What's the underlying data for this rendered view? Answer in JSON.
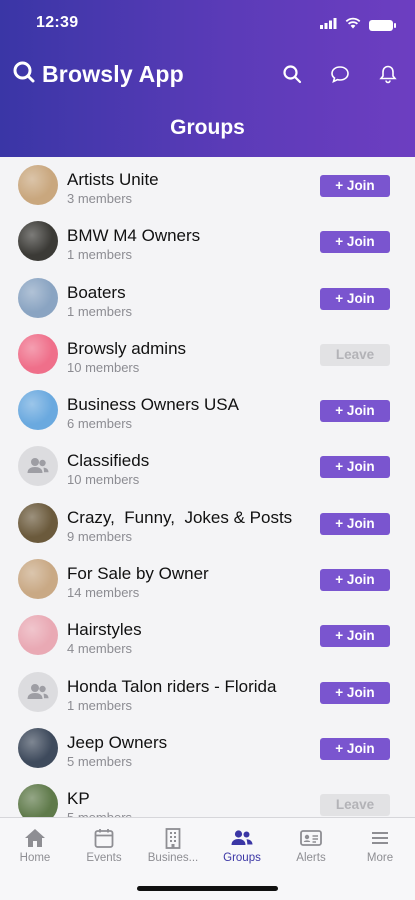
{
  "status": {
    "time": "12:39"
  },
  "app": {
    "title": "Browsly App",
    "page_title": "Groups"
  },
  "groups": [
    {
      "name": "Artists Unite",
      "members": "3 members",
      "action": "+ Join",
      "avatar_color": "#c9a77e"
    },
    {
      "name": "BMW M4 Owners",
      "members": "1 members",
      "action": "+ Join",
      "avatar_color": "#3b3a36"
    },
    {
      "name": "Boaters",
      "members": "1 members",
      "action": "+ Join",
      "avatar_color": "#8aa4c2"
    },
    {
      "name": "Browsly admins",
      "members": "10 members",
      "action": "Leave",
      "avatar_color": "#ef6f8a"
    },
    {
      "name": "Business Owners USA",
      "members": "6 members",
      "action": "+ Join",
      "avatar_color": "#6aa9df"
    },
    {
      "name": "Classifieds",
      "members": "10 members",
      "action": "+ Join",
      "avatar_color": ""
    },
    {
      "name": "Crazy,  Funny,  Jokes & Posts",
      "members": "9 members",
      "action": "+ Join",
      "avatar_color": "#6b5a3c"
    },
    {
      "name": "For Sale by Owner",
      "members": "14 members",
      "action": "+ Join",
      "avatar_color": "#c9a985"
    },
    {
      "name": "Hairstyles",
      "members": "4 members",
      "action": "+ Join",
      "avatar_color": "#e9a9b4"
    },
    {
      "name": "Honda Talon riders - Florida",
      "members": "1 members",
      "action": "+ Join",
      "avatar_color": ""
    },
    {
      "name": "Jeep Owners",
      "members": "5 members",
      "action": "+ Join",
      "avatar_color": "#3e4a5c"
    },
    {
      "name": "KP",
      "members": "5 members",
      "action": "Leave",
      "avatar_color": "#5f7a4a"
    }
  ],
  "tabs": [
    {
      "label": "Home",
      "icon": "home-icon"
    },
    {
      "label": "Events",
      "icon": "calendar-icon"
    },
    {
      "label": "Busines...",
      "icon": "building-icon"
    },
    {
      "label": "Groups",
      "icon": "people-icon",
      "active": true
    },
    {
      "label": "Alerts",
      "icon": "alert-card-icon"
    },
    {
      "label": "More",
      "icon": "menu-icon"
    }
  ],
  "colors": {
    "accent": "#7a55cf",
    "header_start": "#3a36a6",
    "header_end": "#6d3ec1",
    "active_tab": "#3b36a5"
  }
}
